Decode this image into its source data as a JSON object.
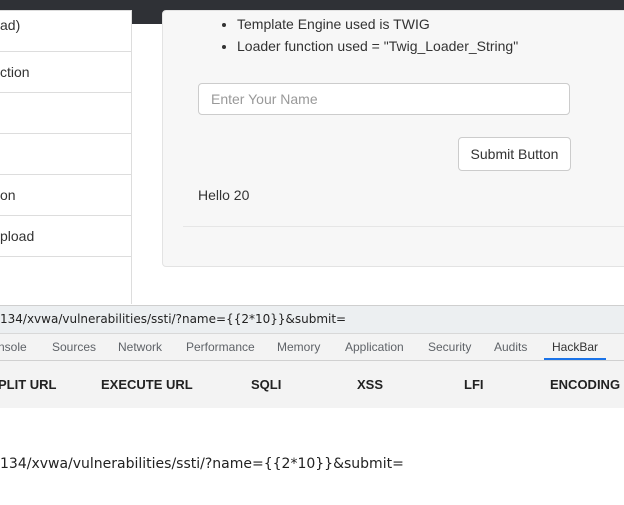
{
  "sidebar": {
    "items": [
      {
        "label": "ad)"
      },
      {
        "label": "ction"
      },
      {
        "label": ""
      },
      {
        "label": ""
      },
      {
        "label": "on"
      },
      {
        "label": "pload"
      },
      {
        "label": ""
      }
    ]
  },
  "main": {
    "bullets": [
      "Template Engine used is TWIG",
      "Loader function used = \"Twig_Loader_String\""
    ],
    "name_placeholder": "Enter Your Name",
    "submit_label": "Submit Button",
    "result_text": "Hello 20"
  },
  "devtools": {
    "page_url": "134/xvwa/vulnerabilities/ssti/?name={{2*10}}&submit=",
    "tabs": [
      "nsole",
      "Sources",
      "Network",
      "Performance",
      "Memory",
      "Application",
      "Security",
      "Audits",
      "HackBar"
    ],
    "active_tab": "HackBar",
    "hackbar": {
      "actions": [
        "PLIT URL",
        "EXECUTE URL",
        "SQLI",
        "XSS",
        "LFI",
        "ENCODING"
      ],
      "url_value": "134/xvwa/vulnerabilities/ssti/?name={{2*10}}&submit="
    }
  },
  "colors": {
    "active_tab_underline": "#1a73e8",
    "topbar": "#2f3136"
  }
}
